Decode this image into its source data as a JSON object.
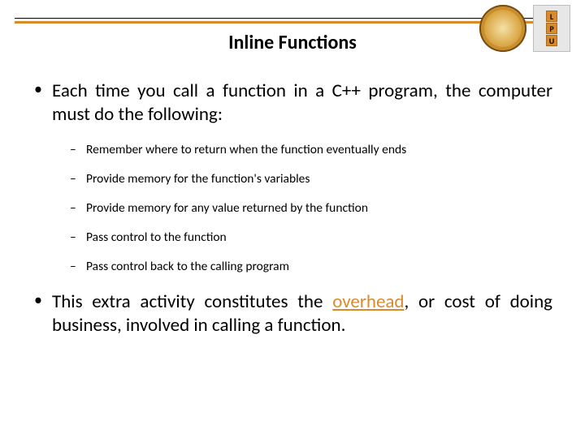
{
  "title": "Inline Functions",
  "logo_letters": [
    "L",
    "P",
    "U"
  ],
  "bullets": {
    "intro": "Each time you call a function in a C++ program, the computer must do the following:",
    "subs": [
      "Remember where to return when the function eventually ends",
      "Provide memory for the function's variables",
      "Provide memory for any value returned by the function",
      "Pass control to the function",
      "Pass control back to the calling program"
    ],
    "conclusion_pre": "This extra activity constitutes the ",
    "conclusion_highlight": "overhead",
    "conclusion_post": ", or cost of doing business, involved in calling a function."
  }
}
